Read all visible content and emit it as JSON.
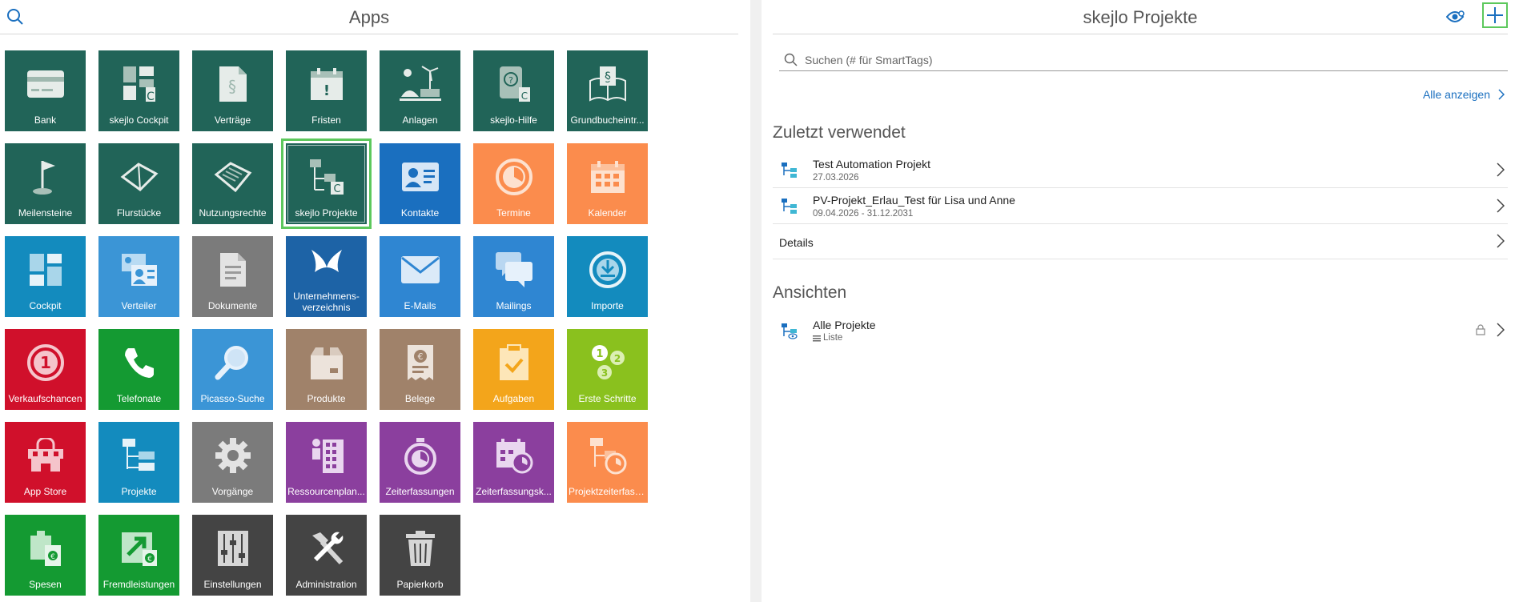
{
  "left": {
    "title": "Apps",
    "tiles": [
      {
        "label": "Bank",
        "icon": "bank-card-icon"
      },
      {
        "label": "skejlo Cockpit",
        "icon": "cockpit-grid-icon"
      },
      {
        "label": "Verträge",
        "icon": "contract-paragraph-icon"
      },
      {
        "label": "Fristen",
        "icon": "deadline-calendar-icon"
      },
      {
        "label": "Anlagen",
        "icon": "energy-plant-icon"
      },
      {
        "label": "skejlo-Hilfe",
        "icon": "help-book-icon"
      },
      {
        "label": "Grundbucheintr...",
        "icon": "land-register-book-icon"
      },
      {
        "label": "Meilensteine",
        "icon": "milestone-flag-icon"
      },
      {
        "label": "Flurstücke",
        "icon": "parcel-map-icon"
      },
      {
        "label": "Nutzungsrechte",
        "icon": "usage-rights-map-icon"
      },
      {
        "label": "skejlo Projekte",
        "icon": "project-tree-icon"
      },
      {
        "label": "Kontakte",
        "icon": "contact-card-icon"
      },
      {
        "label": "Termine",
        "icon": "appointment-clock-icon"
      },
      {
        "label": "Kalender",
        "icon": "calendar-icon"
      },
      {
        "label": "Cockpit",
        "icon": "cockpit-icon"
      },
      {
        "label": "Verteiler",
        "icon": "distribution-list-icon"
      },
      {
        "label": "Dokumente",
        "icon": "document-icon"
      },
      {
        "label": "Unternehmens-verzeichnis",
        "icon": "company-directory-icon"
      },
      {
        "label": "E-Mails",
        "icon": "envelope-icon"
      },
      {
        "label": "Mailings",
        "icon": "mailing-chat-icon"
      },
      {
        "label": "Importe",
        "icon": "import-download-icon"
      },
      {
        "label": "Verkaufschancen",
        "icon": "sales-opportunity-icon"
      },
      {
        "label": "Telefonate",
        "icon": "phone-icon"
      },
      {
        "label": "Picasso-Suche",
        "icon": "magnifier-icon"
      },
      {
        "label": "Produkte",
        "icon": "product-box-icon"
      },
      {
        "label": "Belege",
        "icon": "receipt-euro-icon"
      },
      {
        "label": "Aufgaben",
        "icon": "task-clipboard-icon"
      },
      {
        "label": "Erste Schritte",
        "icon": "first-steps-icon"
      },
      {
        "label": "App Store",
        "icon": "app-store-icon"
      },
      {
        "label": "Projekte",
        "icon": "projects-tree-icon"
      },
      {
        "label": "Vorgänge",
        "icon": "gear-icon"
      },
      {
        "label": "Ressourcenplan...",
        "icon": "resource-plan-icon"
      },
      {
        "label": "Zeiterfassungen",
        "icon": "stopwatch-icon"
      },
      {
        "label": "Zeiterfassungsk...",
        "icon": "time-calendar-icon"
      },
      {
        "label": "Projektzeiterfass...",
        "icon": "project-time-icon"
      },
      {
        "label": "Spesen",
        "icon": "expenses-icon"
      },
      {
        "label": "Fremdleistungen",
        "icon": "external-services-icon"
      },
      {
        "label": "Einstellungen",
        "icon": "settings-sliders-icon"
      },
      {
        "label": "Administration",
        "icon": "tools-icon"
      },
      {
        "label": "Papierkorb",
        "icon": "trash-icon"
      }
    ]
  },
  "right": {
    "title": "skejlo Projekte",
    "search_placeholder": "Suchen (# für SmartTags)",
    "show_all": "Alle anzeigen",
    "recent_title": "Zuletzt verwendet",
    "recent": [
      {
        "name": "Test Automation Projekt",
        "date": "27.03.2026"
      },
      {
        "name": "PV-Projekt_Erlau_Test für Lisa und Anne",
        "date": "09.04.2026 - 31.12.2031"
      }
    ],
    "details": "Details",
    "views_title": "Ansichten",
    "views": [
      {
        "name": "Alle Projekte",
        "sub": "Liste"
      }
    ]
  }
}
